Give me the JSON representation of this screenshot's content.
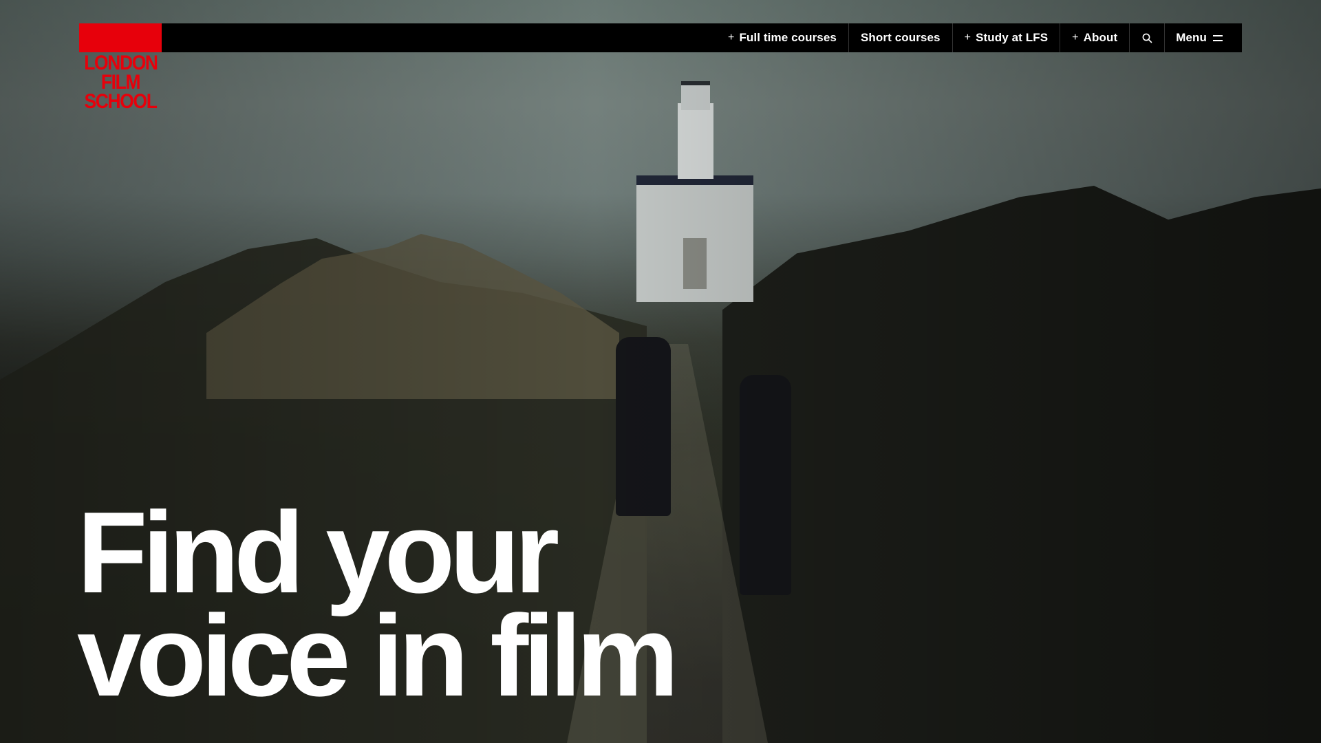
{
  "logo": {
    "lines": [
      "LONDON",
      "FILM",
      "SCHOOL"
    ],
    "brand_color": "#e7000b"
  },
  "nav": {
    "items": [
      {
        "label": "Full time courses",
        "expandable": true
      },
      {
        "label": "Short courses",
        "expandable": false
      },
      {
        "label": "Study at LFS",
        "expandable": true
      },
      {
        "label": "About",
        "expandable": true
      }
    ],
    "search_icon": "search-icon",
    "menu_label": "Menu",
    "menu_icon": "hamburger-icon"
  },
  "hero": {
    "headline_lines": [
      "Find your",
      "voice in film"
    ]
  }
}
